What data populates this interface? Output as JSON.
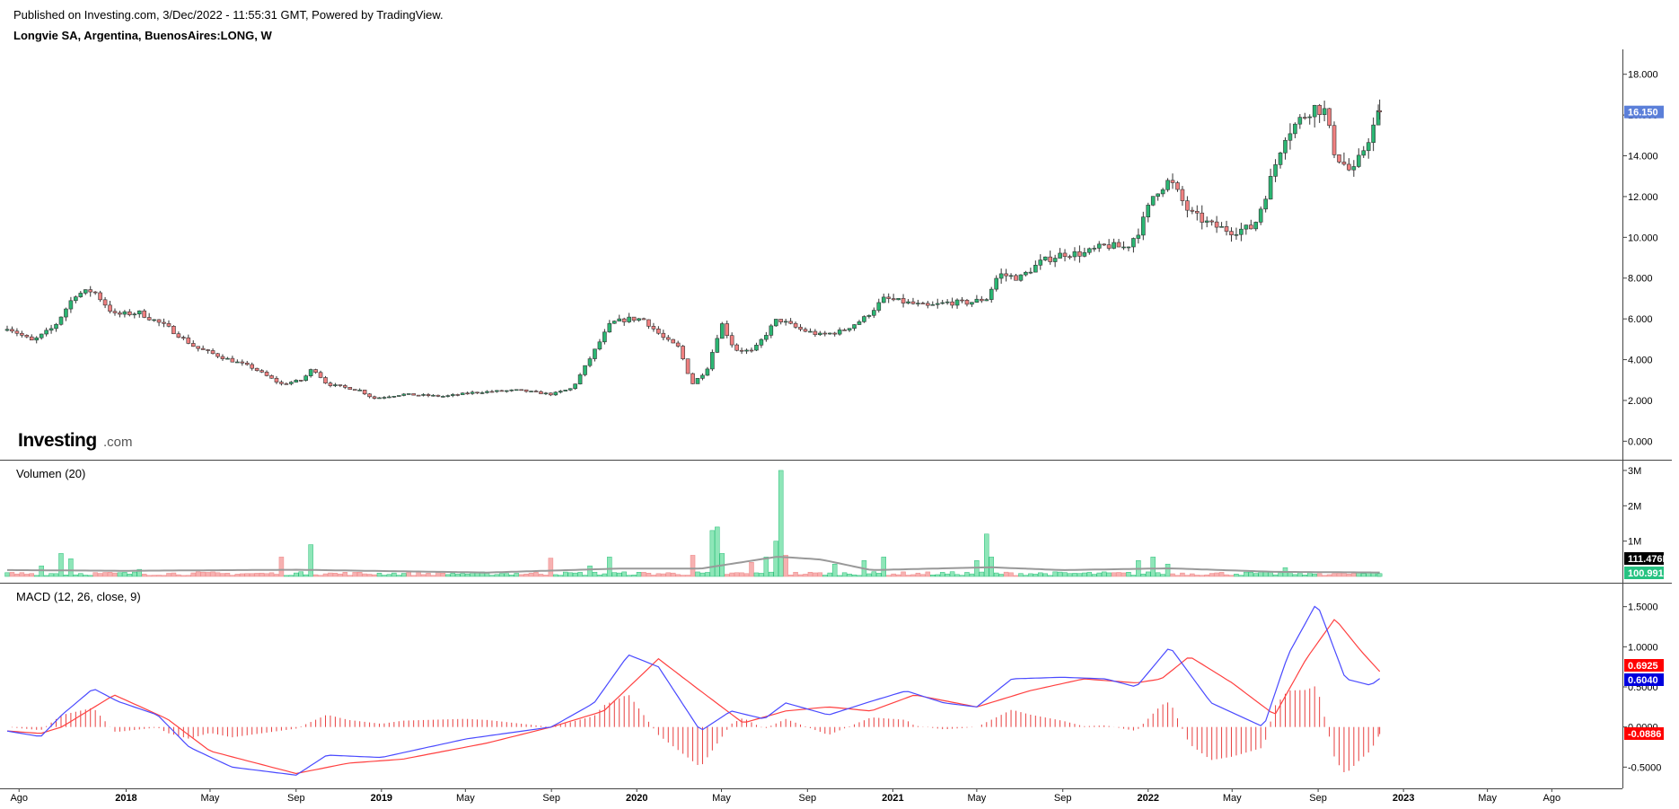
{
  "header": {
    "published": "Published on Investing.com, 3/Dec/2022 - 11:55:31 GMT, Powered by TradingView.",
    "symbol": "Longvie SA, Argentina, BuenosAires:LONG, W"
  },
  "logo": {
    "main": "Investing",
    "suffix": ".com"
  },
  "colors": {
    "up": "#26a65b",
    "up_fill": "#2bb673",
    "down": "#d9534f",
    "down_fill": "#f08080",
    "vol_up": "#8ee6b8",
    "vol_down": "#f7b1b1",
    "vol_ma": "#999999",
    "macd_line": "#4a4aff",
    "signal_line": "#ff4040",
    "hist": "#e84040",
    "price_badge": "#5b7fd9",
    "vol_badge1": "#000000",
    "vol_badge2": "#26c281",
    "macd_badge_signal": "#ff0000",
    "macd_badge_macd": "#0000dd",
    "macd_badge_hist": "#ff0000"
  },
  "chart_data": [
    {
      "type": "candlestick",
      "pane": "price",
      "x_range": [
        "2017-07-15",
        "2023-11-01"
      ],
      "ylim": [
        -0.6,
        19.0
      ],
      "yticks": [
        "18.000",
        "16.000",
        "14.000",
        "12.000",
        "10.000",
        "8.000",
        "6.000",
        "4.000",
        "2.000",
        "0.000"
      ],
      "ytick_values": [
        18,
        16,
        14,
        12,
        10,
        8,
        6,
        4,
        2,
        0
      ],
      "close_path_points": [
        [
          "2017-07-15",
          5.6
        ],
        [
          "2017-08-20",
          4.9
        ],
        [
          "2017-09-20",
          5.6
        ],
        [
          "2017-10-20",
          7.2
        ],
        [
          "2017-11-15",
          7.4
        ],
        [
          "2017-12-15",
          6.2
        ],
        [
          "2018-01-20",
          6.3
        ],
        [
          "2018-03-01",
          5.6
        ],
        [
          "2018-04-10",
          4.6
        ],
        [
          "2018-05-20",
          4.1
        ],
        [
          "2018-07-01",
          3.6
        ],
        [
          "2018-08-10",
          2.8
        ],
        [
          "2018-09-10",
          3.0
        ],
        [
          "2018-09-25",
          3.6
        ],
        [
          "2018-10-15",
          2.8
        ],
        [
          "2018-12-01",
          2.5
        ],
        [
          "2018-12-20",
          2.1
        ],
        [
          "2019-02-01",
          2.3
        ],
        [
          "2019-04-01",
          2.2
        ],
        [
          "2019-05-15",
          2.4
        ],
        [
          "2019-07-15",
          2.5
        ],
        [
          "2019-09-01",
          2.3
        ],
        [
          "2019-10-01",
          2.6
        ],
        [
          "2019-10-25",
          4.0
        ],
        [
          "2019-11-25",
          5.8
        ],
        [
          "2019-12-20",
          6.0
        ],
        [
          "2020-01-10",
          6.0
        ],
        [
          "2020-02-10",
          5.0
        ],
        [
          "2020-03-01",
          4.6
        ],
        [
          "2020-03-20",
          2.8
        ],
        [
          "2020-04-10",
          3.5
        ],
        [
          "2020-05-01",
          5.8
        ],
        [
          "2020-05-20",
          4.5
        ],
        [
          "2020-06-15",
          4.4
        ],
        [
          "2020-07-20",
          6.0
        ],
        [
          "2020-08-20",
          5.5
        ],
        [
          "2020-09-20",
          5.2
        ],
        [
          "2020-10-20",
          5.4
        ],
        [
          "2020-11-20",
          6.0
        ],
        [
          "2020-12-20",
          7.0
        ],
        [
          "2021-01-20",
          6.8
        ],
        [
          "2021-02-20",
          6.6
        ],
        [
          "2021-03-20",
          6.8
        ],
        [
          "2021-04-20",
          6.8
        ],
        [
          "2021-05-15",
          7.0
        ],
        [
          "2021-06-01",
          8.2
        ],
        [
          "2021-07-01",
          8.0
        ],
        [
          "2021-08-01",
          8.8
        ],
        [
          "2021-09-01",
          9.2
        ],
        [
          "2021-10-01",
          9.2
        ],
        [
          "2021-11-01",
          9.6
        ],
        [
          "2021-12-01",
          9.5
        ],
        [
          "2021-12-20",
          10.4
        ],
        [
          "2022-01-10",
          12.2
        ],
        [
          "2022-02-01",
          12.8
        ],
        [
          "2022-03-01",
          11.2
        ],
        [
          "2022-04-01",
          10.6
        ],
        [
          "2022-05-01",
          10.3
        ],
        [
          "2022-06-01",
          10.5
        ],
        [
          "2022-06-20",
          12.3
        ],
        [
          "2022-07-15",
          15.0
        ],
        [
          "2022-08-10",
          15.9
        ],
        [
          "2022-08-25",
          16.4
        ],
        [
          "2022-09-10",
          16.2
        ],
        [
          "2022-09-25",
          14.1
        ],
        [
          "2022-10-20",
          13.1
        ],
        [
          "2022-11-10",
          14.7
        ],
        [
          "2022-11-28",
          16.15
        ]
      ],
      "last_price_label": "16.150"
    },
    {
      "type": "bar",
      "pane": "volume",
      "title": "Volumen (20)",
      "ylim": [
        0,
        3100000
      ],
      "yticks": [
        "3M",
        "2M",
        "1M"
      ],
      "ytick_values": [
        3000000,
        2000000,
        1000000
      ],
      "base_volume": 90000,
      "spikes": [
        [
          "2017-09-01",
          300000
        ],
        [
          "2017-10-01",
          650000
        ],
        [
          "2017-10-15",
          500000
        ],
        [
          "2018-01-20",
          200000
        ],
        [
          "2018-08-10",
          550000
        ],
        [
          "2018-09-25",
          900000
        ],
        [
          "2019-09-01",
          520000
        ],
        [
          "2019-10-25",
          300000
        ],
        [
          "2019-11-25",
          550000
        ],
        [
          "2020-03-20",
          600000
        ],
        [
          "2020-04-20",
          1300000
        ],
        [
          "2020-04-27",
          1400000
        ],
        [
          "2020-05-04",
          650000
        ],
        [
          "2020-06-15",
          400000
        ],
        [
          "2020-07-01",
          550000
        ],
        [
          "2020-07-15",
          1000000
        ],
        [
          "2020-07-22",
          3000000
        ],
        [
          "2020-08-01",
          600000
        ],
        [
          "2020-10-10",
          350000
        ],
        [
          "2020-11-20",
          450000
        ],
        [
          "2020-12-20",
          550000
        ],
        [
          "2021-05-01",
          450000
        ],
        [
          "2021-05-15",
          1200000
        ],
        [
          "2021-05-22",
          550000
        ],
        [
          "2021-12-20",
          450000
        ],
        [
          "2022-01-10",
          550000
        ],
        [
          "2022-02-01",
          350000
        ],
        [
          "2022-07-15",
          250000
        ]
      ],
      "ma_points": [
        [
          "2017-07-15",
          180000
        ],
        [
          "2018-01-01",
          160000
        ],
        [
          "2018-09-01",
          190000
        ],
        [
          "2019-06-01",
          110000
        ],
        [
          "2019-12-01",
          220000
        ],
        [
          "2020-04-01",
          220000
        ],
        [
          "2020-07-20",
          560000
        ],
        [
          "2020-09-20",
          480000
        ],
        [
          "2020-12-01",
          180000
        ],
        [
          "2021-05-20",
          260000
        ],
        [
          "2021-09-01",
          180000
        ],
        [
          "2022-02-01",
          230000
        ],
        [
          "2022-07-01",
          130000
        ],
        [
          "2022-11-28",
          111476
        ]
      ],
      "last_labels": [
        "111.476K",
        "100.991K"
      ]
    },
    {
      "type": "line",
      "pane": "macd",
      "title": "MACD (12, 26, close, 9)",
      "ylim": [
        -0.72,
        1.72
      ],
      "yticks": [
        "1.5000",
        "1.0000",
        "0.5000",
        "0.0000",
        "-0.5000"
      ],
      "ytick_values": [
        1.5,
        1.0,
        0.5,
        0.0,
        -0.5
      ],
      "series": [
        {
          "name": "MACD",
          "points": [
            [
              "2017-07-15",
              -0.05
            ],
            [
              "2017-09-01",
              -0.12
            ],
            [
              "2017-10-01",
              0.15
            ],
            [
              "2017-11-15",
              0.48
            ],
            [
              "2017-12-20",
              0.32
            ],
            [
              "2018-02-15",
              0.15
            ],
            [
              "2018-04-01",
              -0.25
            ],
            [
              "2018-06-01",
              -0.5
            ],
            [
              "2018-09-01",
              -0.6
            ],
            [
              "2018-10-15",
              -0.35
            ],
            [
              "2019-01-01",
              -0.38
            ],
            [
              "2019-05-01",
              -0.15
            ],
            [
              "2019-09-01",
              0.0
            ],
            [
              "2019-11-01",
              0.3
            ],
            [
              "2019-12-20",
              0.9
            ],
            [
              "2020-02-01",
              0.75
            ],
            [
              "2020-04-01",
              -0.05
            ],
            [
              "2020-05-15",
              0.2
            ],
            [
              "2020-07-01",
              0.1
            ],
            [
              "2020-08-01",
              0.3
            ],
            [
              "2020-10-01",
              0.15
            ],
            [
              "2020-12-01",
              0.32
            ],
            [
              "2021-01-20",
              0.45
            ],
            [
              "2021-03-15",
              0.3
            ],
            [
              "2021-05-01",
              0.25
            ],
            [
              "2021-06-20",
              0.6
            ],
            [
              "2021-09-01",
              0.62
            ],
            [
              "2021-11-01",
              0.6
            ],
            [
              "2021-12-15",
              0.5
            ],
            [
              "2022-02-01",
              1.0
            ],
            [
              "2022-04-01",
              0.3
            ],
            [
              "2022-06-15",
              0.0
            ],
            [
              "2022-07-20",
              0.9
            ],
            [
              "2022-08-30",
              1.55
            ],
            [
              "2022-10-10",
              0.6
            ],
            [
              "2022-11-15",
              0.52
            ],
            [
              "2022-11-28",
              0.604
            ]
          ]
        },
        {
          "name": "Signal",
          "points": [
            [
              "2017-07-15",
              -0.05
            ],
            [
              "2017-09-01",
              -0.08
            ],
            [
              "2017-10-01",
              0.0
            ],
            [
              "2017-12-15",
              0.4
            ],
            [
              "2018-03-01",
              0.1
            ],
            [
              "2018-05-01",
              -0.3
            ],
            [
              "2018-09-01",
              -0.58
            ],
            [
              "2018-11-15",
              -0.45
            ],
            [
              "2019-02-01",
              -0.4
            ],
            [
              "2019-06-01",
              -0.2
            ],
            [
              "2019-09-01",
              0.0
            ],
            [
              "2019-11-15",
              0.2
            ],
            [
              "2020-02-01",
              0.85
            ],
            [
              "2020-04-01",
              0.45
            ],
            [
              "2020-06-01",
              0.05
            ],
            [
              "2020-08-01",
              0.2
            ],
            [
              "2020-10-01",
              0.25
            ],
            [
              "2020-12-01",
              0.2
            ],
            [
              "2021-02-01",
              0.4
            ],
            [
              "2021-05-01",
              0.25
            ],
            [
              "2021-07-15",
              0.45
            ],
            [
              "2021-10-01",
              0.6
            ],
            [
              "2021-12-15",
              0.55
            ],
            [
              "2022-01-20",
              0.6
            ],
            [
              "2022-03-01",
              0.88
            ],
            [
              "2022-05-01",
              0.55
            ],
            [
              "2022-07-01",
              0.15
            ],
            [
              "2022-08-15",
              0.85
            ],
            [
              "2022-09-25",
              1.35
            ],
            [
              "2022-11-01",
              0.95
            ],
            [
              "2022-11-28",
              0.6925
            ]
          ]
        }
      ],
      "last_labels": [
        "0.6925",
        "0.6040",
        "-0.0886"
      ]
    }
  ],
  "x_axis": {
    "labels": [
      [
        "Ago",
        "2017-08-01",
        false
      ],
      [
        "2018",
        "2018-01-01",
        true
      ],
      [
        "May",
        "2018-05-01",
        false
      ],
      [
        "Sep",
        "2018-09-01",
        false
      ],
      [
        "2019",
        "2019-01-01",
        true
      ],
      [
        "May",
        "2019-05-01",
        false
      ],
      [
        "Sep",
        "2019-09-01",
        false
      ],
      [
        "2020",
        "2020-01-01",
        true
      ],
      [
        "May",
        "2020-05-01",
        false
      ],
      [
        "Sep",
        "2020-09-01",
        false
      ],
      [
        "2021",
        "2021-01-01",
        true
      ],
      [
        "May",
        "2021-05-01",
        false
      ],
      [
        "Sep",
        "2021-09-01",
        false
      ],
      [
        "2022",
        "2022-01-01",
        true
      ],
      [
        "May",
        "2022-05-01",
        false
      ],
      [
        "Sep",
        "2022-09-01",
        false
      ],
      [
        "2023",
        "2023-01-01",
        true
      ],
      [
        "May",
        "2023-05-01",
        false
      ],
      [
        "Ago",
        "2023-08-01",
        false
      ]
    ]
  }
}
